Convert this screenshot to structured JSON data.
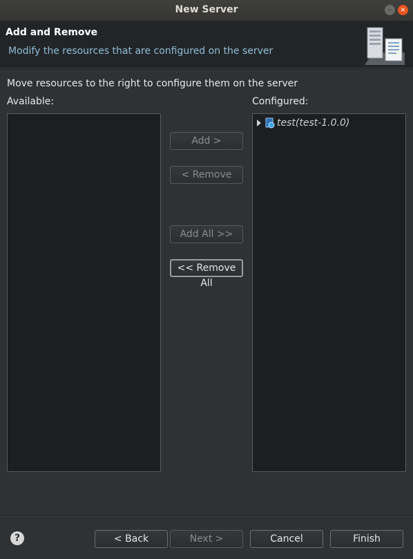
{
  "window": {
    "title": "New Server",
    "minimize_glyph": "–",
    "close_glyph": "×"
  },
  "header": {
    "title": "Add and Remove",
    "description": "Modify the resources that are configured on the server"
  },
  "main": {
    "instruction": "Move resources to the right to configure them on the server",
    "available_label": "Available:",
    "configured_label": "Configured:",
    "available_items": [],
    "configured_items": [
      {
        "label": "test(test-1.0.0)",
        "icon": "web-module-icon",
        "expanded": false
      }
    ]
  },
  "buttons": {
    "add": "Add >",
    "remove": "< Remove",
    "add_all": "Add All >>",
    "remove_all": "<< Remove All"
  },
  "footer": {
    "help_glyph": "?",
    "back": "< Back",
    "next": "Next >",
    "cancel": "Cancel",
    "finish": "Finish"
  },
  "colors": {
    "background": "#2f3234",
    "header_bg": "#222527",
    "list_bg": "#1c1f21",
    "description_text": "#8fbfd9",
    "close_button": "#e9541f"
  }
}
